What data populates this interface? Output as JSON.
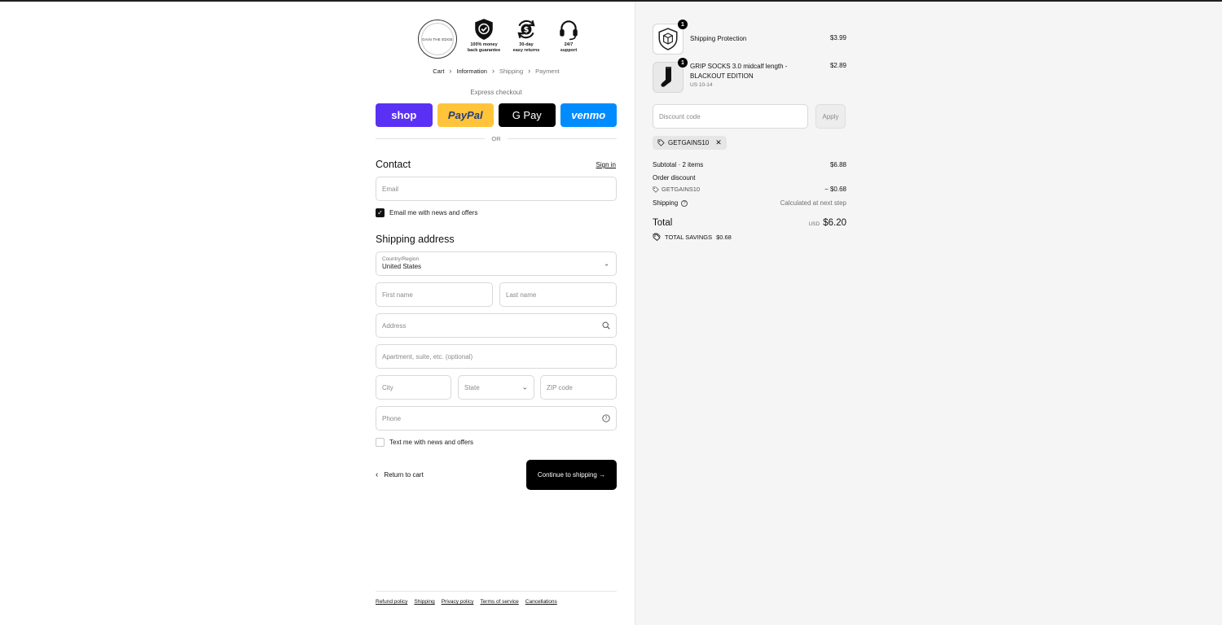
{
  "brand": {
    "logo_text": "GAIN THE EDGE"
  },
  "badges": [
    {
      "icon": "shield-check-icon",
      "label": "100% money\nback guarantee"
    },
    {
      "icon": "dollar-returns-icon",
      "label": "30-day\neasy returns"
    },
    {
      "icon": "headset-icon",
      "label": "24/7\nsupport"
    }
  ],
  "breadcrumb": [
    "Cart",
    "Information",
    "Shipping",
    "Payment"
  ],
  "express": {
    "title": "Express checkout",
    "shop": "shop",
    "paypal": "PayPal",
    "gpay": "G Pay",
    "venmo": "venmo",
    "or": "OR"
  },
  "contact": {
    "title": "Contact",
    "signin": "Sign in",
    "email_placeholder": "Email",
    "news_label": "Email me with news and offers",
    "news_checked": true
  },
  "shipping": {
    "title": "Shipping address",
    "country_label": "Country/Region",
    "country_value": "United States",
    "first_placeholder": "First name",
    "last_placeholder": "Last name",
    "address_placeholder": "Address",
    "apt_placeholder": "Apartment, suite, etc. (optional)",
    "city_placeholder": "City",
    "state_placeholder": "State",
    "zip_placeholder": "ZIP code",
    "phone_placeholder": "Phone",
    "text_label": "Text me with news and offers",
    "text_checked": false
  },
  "actions": {
    "return": "Return to cart",
    "continue": "Continue to shipping →"
  },
  "footer": [
    "Refund policy",
    "Shipping",
    "Privacy policy",
    "Terms of service",
    "Cancellations"
  ],
  "summary": {
    "items": [
      {
        "name": "Shipping Protection",
        "variant": "",
        "price": "$3.99",
        "qty": "1",
        "thumb_icon": "package-shield-icon"
      },
      {
        "name": "GRIP SOCKS 3.0 midcalf length - BLACKOUT EDITION",
        "variant": "US 10-14",
        "price": "$2.89",
        "qty": "1",
        "thumb_icon": "sock-icon"
      }
    ],
    "discount_placeholder": "Discount code",
    "apply": "Apply",
    "applied_code": "GETGAINS10",
    "subtotal_label": "Subtotal · 2 items",
    "subtotal_value": "$6.88",
    "order_discount_label": "Order discount",
    "discount_code": "GETGAINS10",
    "discount_value": "− $0.68",
    "shipping_label": "Shipping",
    "shipping_value": "Calculated at next step",
    "total_label": "Total",
    "currency": "USD",
    "total_value": "$6.20",
    "savings_label": "TOTAL SAVINGS",
    "savings_value": "$0.68"
  },
  "colors": {
    "shop": "#5a31f4",
    "paypal": "#ffc439",
    "gpay": "#000000",
    "venmo": "#008cff",
    "primary": "#000000"
  }
}
